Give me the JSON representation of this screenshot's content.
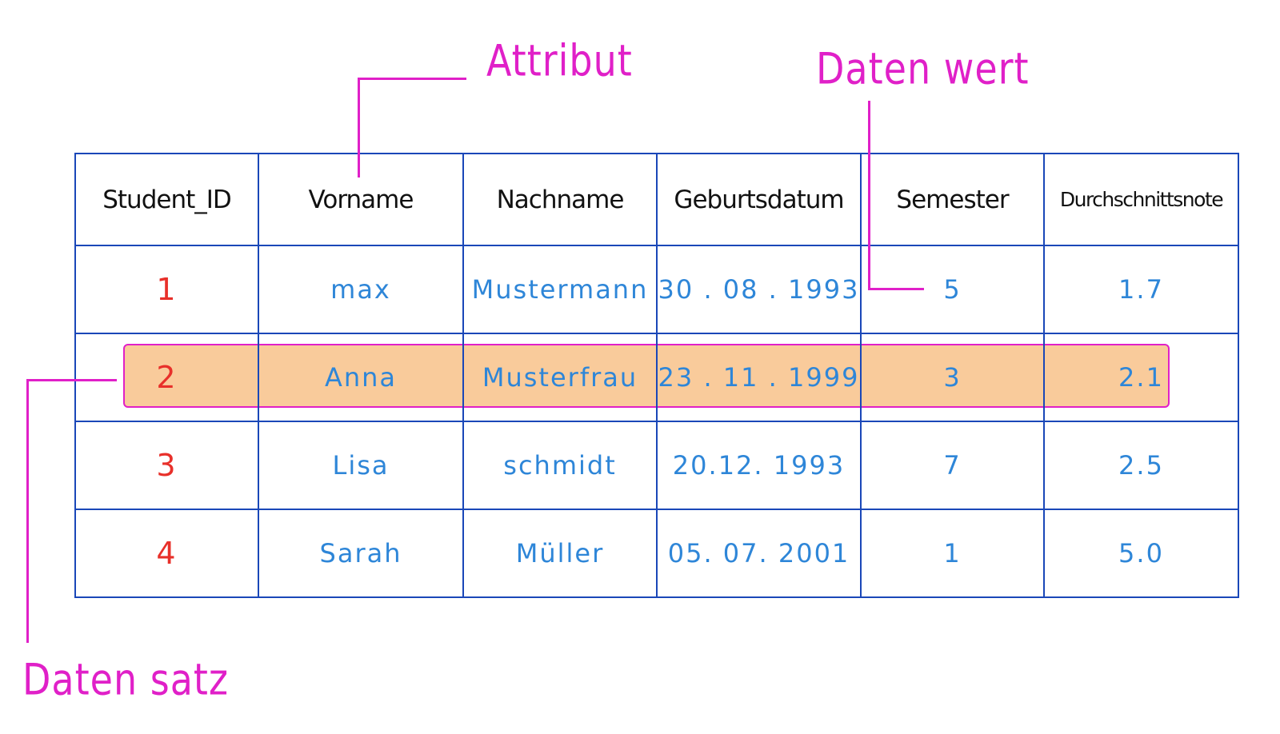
{
  "annotations": {
    "attribut": "Attribut",
    "datenwert": "Daten wert",
    "datensatz": "Daten satz"
  },
  "table": {
    "headers": [
      "Student_ID",
      "Vorname",
      "Nachname",
      "Geburtsdatum",
      "Semester",
      "Durchschnittsnote"
    ],
    "rows": [
      [
        "1",
        "max",
        "Mustermann",
        "30 . 08 . 1993",
        "5",
        "1.7"
      ],
      [
        "2",
        "Anna",
        "Musterfrau",
        "23 . 11 . 1999",
        "3",
        "2.1"
      ],
      [
        "3",
        "Lisa",
        "schmidt",
        "20.12. 1993",
        "7",
        "2.5"
      ],
      [
        "4",
        "Sarah",
        "Müller",
        "05. 07. 2001",
        "1",
        "5.0"
      ]
    ]
  },
  "colors": {
    "annotation": "#e020c8",
    "grid": "#1a47b8",
    "id_text": "#e8302a",
    "value_text": "#2e86d8",
    "header_text": "#111111",
    "highlight": "#f7be82"
  }
}
